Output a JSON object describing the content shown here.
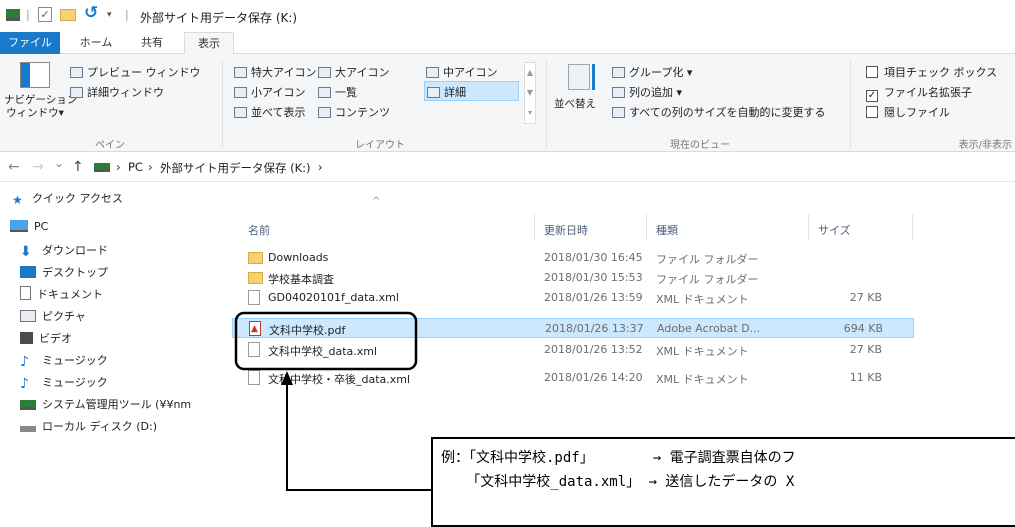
{
  "window": {
    "title": "外部サイト用データ保存 (K:)",
    "qat_separator": "|"
  },
  "tabs": [
    {
      "label": "ファイル"
    },
    {
      "label": "ホーム"
    },
    {
      "label": "共有"
    },
    {
      "label": "表示"
    }
  ],
  "ribbon": {
    "pane": {
      "nav_pane": "ナビゲーション\nウィンドウ▾",
      "nav_pane_line1": "ナビゲーション",
      "nav_pane_line2": "ウィンドウ▾",
      "preview": "プレビュー ウィンドウ",
      "details": "詳細ウィンドウ",
      "group": "ペイン"
    },
    "layout": {
      "xl_icons": "特大アイコン",
      "l_icons": "大アイコン",
      "m_icons": "中アイコン",
      "s_icons": "小アイコン",
      "list": "一覧",
      "details": "詳細",
      "tiles": "並べて表示",
      "content": "コンテンツ",
      "group": "レイアウト"
    },
    "current_view": {
      "sort": "並べ替え",
      "group_by": "グループ化 ▾",
      "add_column": "列の追加 ▾",
      "autosize": "すべての列のサイズを自動的に変更する",
      "group": "現在のビュー"
    },
    "show_hide": {
      "item_checkbox": "項目チェック ボックス",
      "extensions": "ファイル名拡張子",
      "hidden": "隠しファイル",
      "group": "表示/非表示",
      "item_checkbox_checked": false,
      "extensions_checked": true,
      "hidden_checked": false
    }
  },
  "address": {
    "back": "←",
    "forward": "→",
    "recent": "⌄",
    "up": "↑",
    "crumbs": [
      "PC",
      "外部サイト用データ保存 (K:)"
    ],
    "sep": "›"
  },
  "sidebar": {
    "items": [
      {
        "label": "クイック アクセス",
        "icon": "star-icon"
      },
      {
        "label": "PC",
        "icon": "pc-icon"
      },
      {
        "label": "ダウンロード",
        "icon": "download-icon"
      },
      {
        "label": "デスクトップ",
        "icon": "desktop-icon"
      },
      {
        "label": "ドキュメント",
        "icon": "document-icon"
      },
      {
        "label": "ピクチャ",
        "icon": "picture-icon"
      },
      {
        "label": "ビデオ",
        "icon": "video-icon"
      },
      {
        "label": "ミュージック",
        "icon": "music-icon"
      },
      {
        "label": "ミュージック",
        "icon": "music-icon"
      },
      {
        "label": "システム管理用ツール (¥¥nm",
        "icon": "network-drive-icon"
      },
      {
        "label": "ローカル ディスク (D:)",
        "icon": "disk-icon"
      }
    ]
  },
  "columns": {
    "name": "名前",
    "date": "更新日時",
    "type": "種類",
    "size": "サイズ",
    "sort_indicator": "^"
  },
  "files": [
    {
      "name": "Downloads",
      "date": "2018/01/30 16:45",
      "type": "ファイル フォルダー",
      "size": "",
      "kind": "folder"
    },
    {
      "name": "学校基本調査",
      "date": "2018/01/30 15:53",
      "type": "ファイル フォルダー",
      "size": "",
      "kind": "folder"
    },
    {
      "name": "GD04020101f_data.xml",
      "date": "2018/01/26 13:59",
      "type": "XML ドキュメント",
      "size": "27 KB",
      "kind": "doc"
    },
    {
      "name": "文科中学校.pdf",
      "date": "2018/01/26 13:37",
      "type": "Adobe Acrobat D...",
      "size": "694 KB",
      "kind": "pdf"
    },
    {
      "name": "文科中学校_data.xml",
      "date": "2018/01/26 13:52",
      "type": "XML ドキュメント",
      "size": "27 KB",
      "kind": "doc"
    },
    {
      "name": "文科中学校・卒後_data.xml",
      "date": "2018/01/26 14:20",
      "type": "XML ドキュメント",
      "size": "11 KB",
      "kind": "doc"
    }
  ],
  "annotation": {
    "line1": "例：「文科中学校.pdf」       → 電子調査票自体のフ",
    "line2": "   「文科中学校_data.xml」 → 送信したデータの X"
  },
  "colors": {
    "accent": "#1979ca",
    "selection": "#cce8ff",
    "selection_border": "#99d1ff"
  }
}
